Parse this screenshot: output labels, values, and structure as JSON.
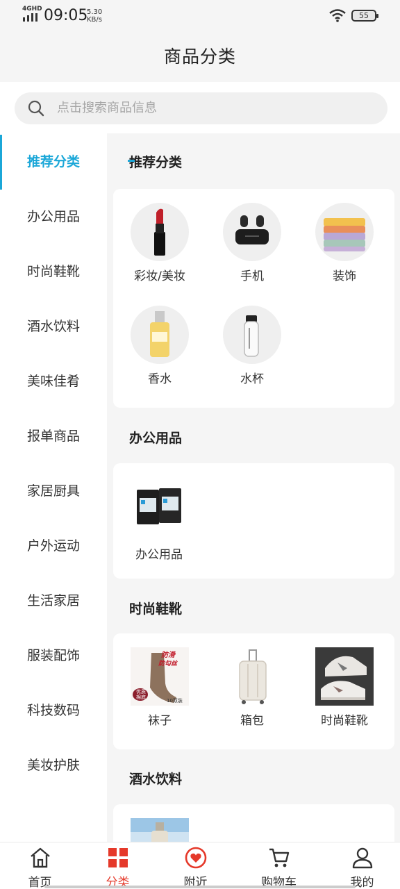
{
  "status_bar": {
    "network": "4GHD",
    "time": "09:05",
    "speed_value": "5.30",
    "speed_unit": "KB/s",
    "battery": "55"
  },
  "header": {
    "title": "商品分类"
  },
  "search": {
    "placeholder": "点击搜索商品信息"
  },
  "sidebar": {
    "items": [
      {
        "label": "推荐分类",
        "active": true
      },
      {
        "label": "办公用品"
      },
      {
        "label": "时尚鞋靴"
      },
      {
        "label": "酒水饮料"
      },
      {
        "label": "美味佳肴"
      },
      {
        "label": "报单商品"
      },
      {
        "label": "家居厨具"
      },
      {
        "label": "户外运动"
      },
      {
        "label": "生活家居"
      },
      {
        "label": "服装配饰"
      },
      {
        "label": "科技数码"
      },
      {
        "label": "美妆护肤"
      }
    ]
  },
  "sections": [
    {
      "title": "推荐分类",
      "items": [
        {
          "label": "彩妆/美妆",
          "icon": "lipstick-icon"
        },
        {
          "label": "手机",
          "icon": "earbuds-icon"
        },
        {
          "label": "装饰",
          "icon": "towels-icon"
        },
        {
          "label": "香水",
          "icon": "perfume-bottle-icon"
        },
        {
          "label": "水杯",
          "icon": "water-bottle-icon"
        }
      ]
    },
    {
      "title": "办公用品",
      "items": [
        {
          "label": "办公用品",
          "icon": "ink-cartridge-icon"
        }
      ]
    },
    {
      "title": "时尚鞋靴",
      "items": [
        {
          "label": "袜子",
          "icon": "socks-icon"
        },
        {
          "label": "箱包",
          "icon": "suitcase-icon"
        },
        {
          "label": "时尚鞋靴",
          "icon": "sneakers-icon"
        }
      ]
    },
    {
      "title": "酒水饮料",
      "items": [
        {
          "icon": "drink-bottle-icon"
        }
      ]
    }
  ],
  "socks_image_text": {
    "top": "防滑",
    "mid": "防勾丝",
    "badge_1": "优质",
    "badge_2": "棉底",
    "count": "10双装"
  },
  "tabbar": {
    "items": [
      {
        "label": "首页",
        "icon": "home-icon"
      },
      {
        "label": "分类",
        "icon": "category-grid-icon",
        "active": true
      },
      {
        "label": "附近",
        "icon": "nearby-heart-icon"
      },
      {
        "label": "购物车",
        "icon": "cart-icon"
      },
      {
        "label": "我的",
        "icon": "user-icon"
      }
    ]
  },
  "colors": {
    "accent": "#1ba7d8",
    "tab_active": "#e5392a",
    "page_bg": "#f5f5f5"
  }
}
